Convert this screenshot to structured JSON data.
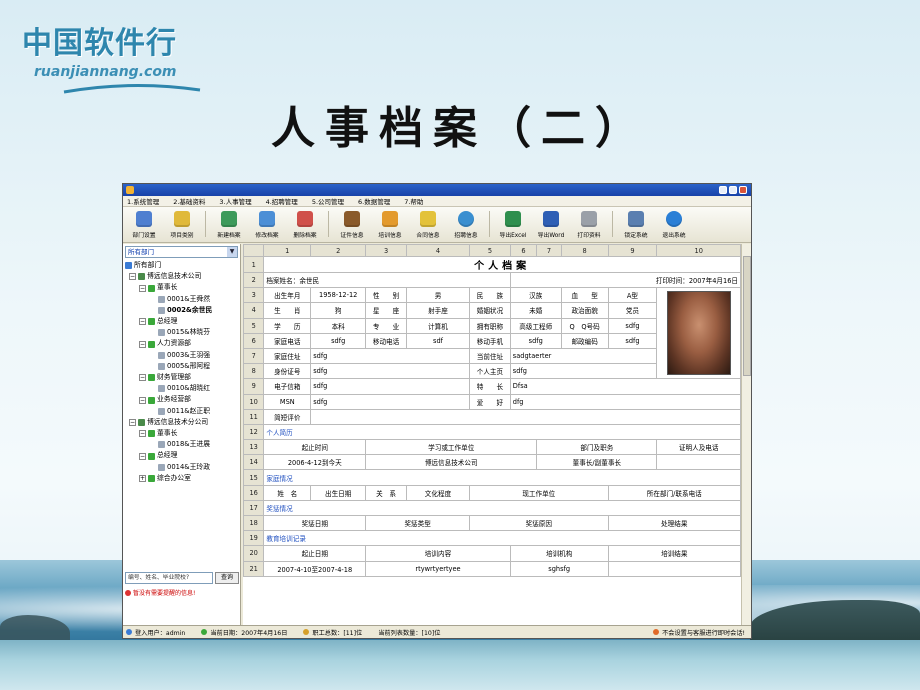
{
  "logo": {
    "cn": "中国软件行",
    "en": "ruanjiannang.com"
  },
  "slide_title": "人事档案（二）",
  "window": {
    "menu": [
      "1.系统管理",
      "2.基础资料",
      "3.人事管理",
      "4.招聘管理",
      "5.公司管理",
      "6.数据管理",
      "7.帮助"
    ],
    "toolbar": [
      "部门设置",
      "项目类别",
      "新建档案",
      "修改档案",
      "删除档案",
      "证件信息",
      "培训信息",
      "合同信息",
      "招聘信息",
      "导出Excel",
      "导出Word",
      "打印资料",
      "锁定系统",
      "退出系统"
    ]
  },
  "left": {
    "dept_select": "所有部门",
    "tree": [
      "所有部门",
      "博远信息技术公司",
      "董事长",
      "0001&王舜然",
      "0002&余世民",
      "总经理",
      "0015&林晓芬",
      "人力资源部",
      "0003&王羽强",
      "0005&邢阿程",
      "财务管理部",
      "0010&胡晓红",
      "业务经营部",
      "0011&赵正职",
      "博远信息技术分公司",
      "董事长",
      "0018&王进展",
      "总经理",
      "0014&王玲政",
      "综合办公室"
    ],
    "search_placeholder": "编号、姓名、毕业院校?",
    "search_button": "查询",
    "warning": "暂没有需要提醒的信息!"
  },
  "sheet": {
    "col_headers": [
      "1",
      "2",
      "3",
      "4",
      "5",
      "6",
      "7",
      "8",
      "9",
      "10"
    ],
    "title": "个人档案",
    "r2_left": "档案姓名：余世民",
    "r2_right": "打印时间：2007年4月16日",
    "r3": [
      "出生年月",
      "1958-12-12",
      "性　　别",
      "男",
      "民　　族",
      "汉族",
      "血　　型",
      "A型"
    ],
    "r4": [
      "生　　肖",
      "狗",
      "星　　座",
      "射手座",
      "婚姻状况",
      "未婚",
      "政治面貌",
      "党员"
    ],
    "r5": [
      "学　　历",
      "本科",
      "专　　业",
      "计算机",
      "拥有职称",
      "高级工程师",
      "Q　Q号码",
      "sdfg"
    ],
    "r6": [
      "家庭电话",
      "sdfg",
      "移动电话",
      "sdf",
      "移动手机",
      "sdfg",
      "邮政编码",
      "sdfg"
    ],
    "r7": [
      "家庭住址",
      "sdfg",
      "当前住址",
      "sadgtaerter"
    ],
    "r8": [
      "身份证号",
      "sdfg",
      "个人主页",
      "sdfg"
    ],
    "r9": [
      "电子信箱",
      "sdfg",
      "特　　长",
      "Dfsa"
    ],
    "r10": [
      "MSN",
      "sdfg",
      "爱　　好",
      "dfg"
    ],
    "r11": "简短评价",
    "r12": "个人简历",
    "r13": [
      "起止时间",
      "学习或工作单位",
      "部门及职务",
      "证明人及电话"
    ],
    "r14": [
      "2006-4-12到今天",
      "博远信息技术公司",
      "董事长/副董事长",
      ""
    ],
    "r15": "家庭情况",
    "r16": [
      "姓　名",
      "出生日期",
      "关　系",
      "文化程度",
      "现工作单位",
      "所在部门/联系电话"
    ],
    "r17": "奖惩情况",
    "r18": [
      "奖惩日期",
      "奖惩类型",
      "奖惩原因",
      "处理结果"
    ],
    "r19": "教育培训记录",
    "r20": [
      "起止日期",
      "培训内容",
      "培训机构",
      "培训结果"
    ],
    "r21": [
      "2007-4-10至2007-4-18",
      "rtywrtyertyee",
      "sghsfg",
      ""
    ]
  },
  "statusbar": {
    "user": "登入用户：admin",
    "date": "当前日期：2007年4月16日",
    "total": "职工总数：[11]位",
    "list_count": "当前列表数量：[10]位",
    "help": "不会设置与客服进行即时会话!"
  },
  "colors": {
    "title_bar": "#2b62c9",
    "section_text": "#2050c0",
    "warning_text": "#cc0000"
  }
}
